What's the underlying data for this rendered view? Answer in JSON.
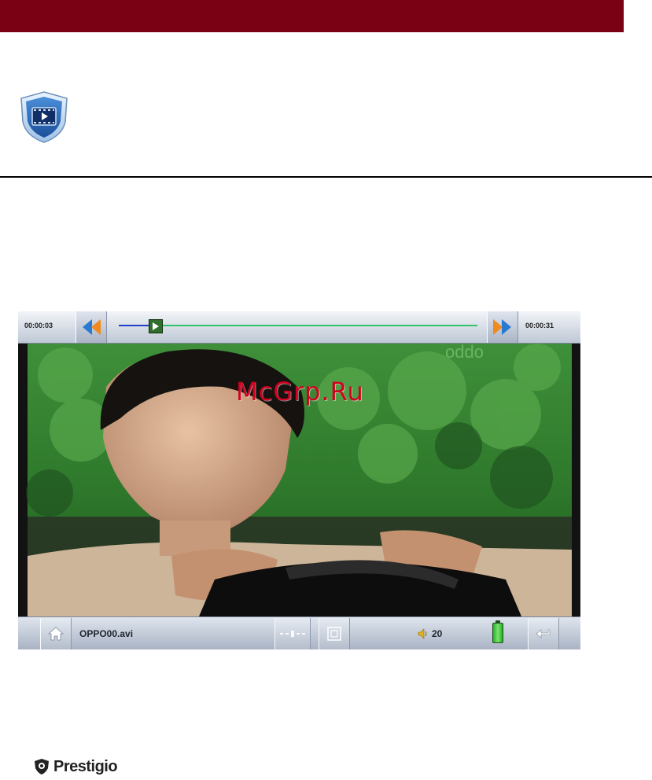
{
  "player": {
    "elapsed": "00:00:03",
    "total": "00:00:31",
    "progress": 0.1,
    "file_name": "OPPO00.avi",
    "volume": "20",
    "video_overlay_text": "oppo"
  },
  "watermark": "McGrp.Ru",
  "brand": {
    "name": "Prestigio"
  },
  "colors": {
    "header_bar": "#7a0014",
    "seek_played": "#1f3ec9",
    "seek_remaining": "#2ec46a",
    "nav_arrows": "#f08a1e",
    "watermark": "#d2001f"
  },
  "icons": [
    "video-app-icon",
    "prev-icon",
    "play-icon",
    "next-icon",
    "home-icon",
    "aspect-ratio-icon",
    "fullscreen-icon",
    "volume-icon",
    "battery-icon",
    "back-icon",
    "prestigio-logo-icon"
  ]
}
